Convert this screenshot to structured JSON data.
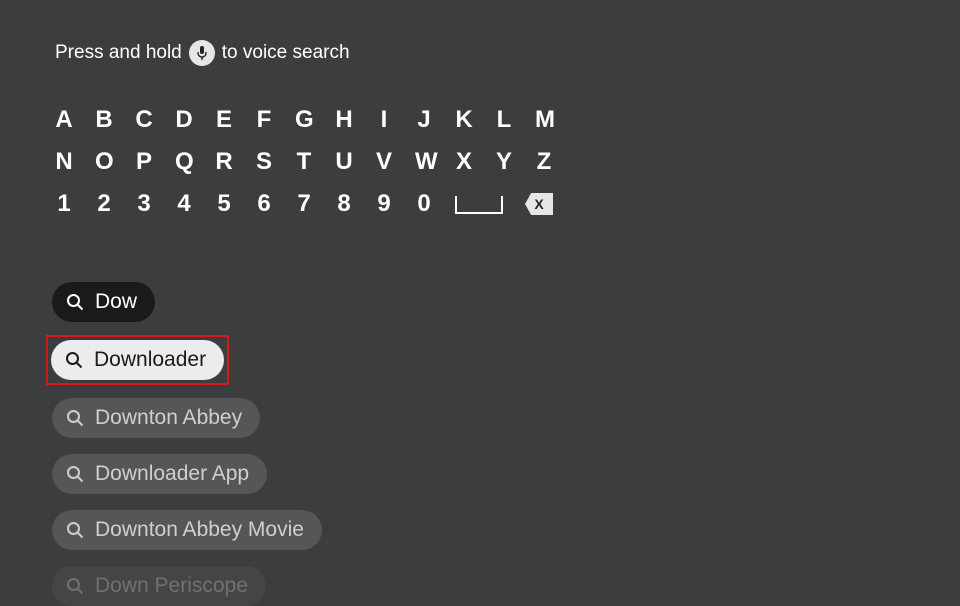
{
  "voice_hint": {
    "prefix": "Press and hold",
    "suffix": "to voice search"
  },
  "keyboard": {
    "row1": [
      "A",
      "B",
      "C",
      "D",
      "E",
      "F",
      "G",
      "H",
      "I",
      "J",
      "K",
      "L",
      "M"
    ],
    "row2": [
      "N",
      "O",
      "P",
      "Q",
      "R",
      "S",
      "T",
      "U",
      "V",
      "W",
      "X",
      "Y",
      "Z"
    ],
    "row3": [
      "1",
      "2",
      "3",
      "4",
      "5",
      "6",
      "7",
      "8",
      "9",
      "0"
    ]
  },
  "search": {
    "query": "Dow",
    "suggestions": [
      {
        "label": "Downloader",
        "selected": true
      },
      {
        "label": "Downton Abbey",
        "selected": false
      },
      {
        "label": "Downloader App",
        "selected": false
      },
      {
        "label": "Downton Abbey Movie",
        "selected": false
      },
      {
        "label": "Down Periscope",
        "selected": false,
        "faded": true
      }
    ]
  }
}
